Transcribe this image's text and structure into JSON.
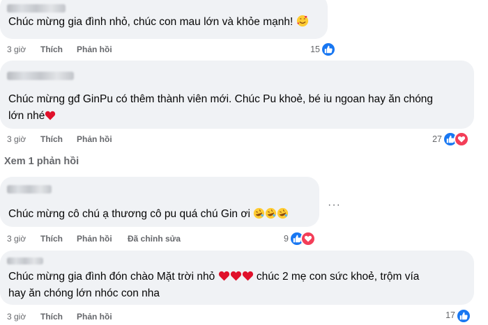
{
  "comments": [
    {
      "text": "Chúc mừng gia đình nhỏ, chúc con mau lớn và khỏe mạnh!",
      "emoji": "smiling-face-with-hearts",
      "time": "3 giờ",
      "like": "Thích",
      "reply": "Phản hồi",
      "reactions": {
        "count": "15",
        "types": [
          "like"
        ]
      }
    },
    {
      "text_lines": [
        "Chúc mừng gđ GinPu có thêm thành viên mới. Chúc Pu khoẻ, bé iu ngoan hay ăn chóng",
        "lớn nhé"
      ],
      "emoji": "red-heart",
      "time": "3 giờ",
      "like": "Thích",
      "reply": "Phản hồi",
      "reactions": {
        "count": "27",
        "types": [
          "like",
          "heart"
        ]
      }
    },
    {
      "text": "Chúc mừng cô chú ạ thương cô pu quá chú Gin ơi",
      "emoji": "rolling-laughing x3",
      "time": "3 giờ",
      "like": "Thích",
      "reply": "Phản hồi",
      "edited": "Đã chỉnh sửa",
      "reactions": {
        "count": "9",
        "types": [
          "like",
          "heart"
        ]
      }
    },
    {
      "text_lines": [
        "Chúc mừng gia đình đón chào Mặt trời nhỏ",
        "chúc 2 mẹ con sức khoẻ, trộm vía",
        "hay ăn chóng lớn nhóc con nha"
      ],
      "emoji": "red-heart x3",
      "time": "3 giờ",
      "like": "Thích",
      "reply": "Phản hồi",
      "reactions": {
        "count": "17",
        "types": [
          "like"
        ]
      }
    }
  ],
  "view_replies": "Xem 1 phản hồi",
  "more_options": "···",
  "colors": {
    "like_blue": "#1877f2",
    "heart_red": "#f33e58",
    "bubble": "#f0f2f5",
    "meta_gray": "#65676b"
  }
}
